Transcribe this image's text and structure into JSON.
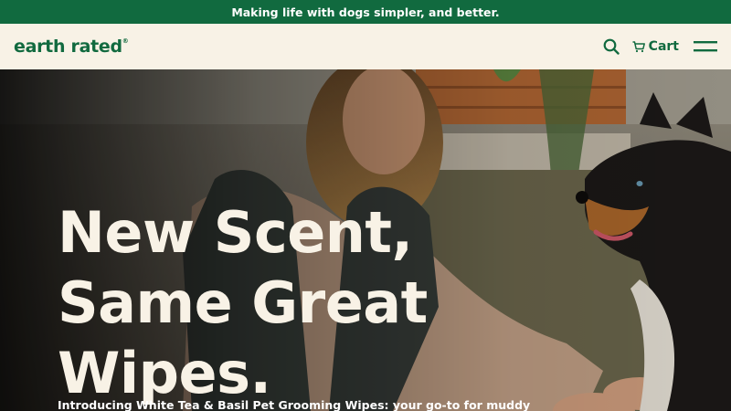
{
  "announcement": {
    "text": "Making life with dogs simpler, and better."
  },
  "header": {
    "logo_text": "earth rated",
    "logo_mark": "®",
    "cart_label": "Cart",
    "icons": {
      "search": "search-icon",
      "cart": "cart-icon",
      "menu": "hamburger-menu-icon"
    }
  },
  "hero": {
    "headline_lines": [
      "New Scent,",
      "Same Great",
      "Wipes."
    ],
    "subtext": "Introducing White Tea & Basil Pet Grooming Wipes: your go-to for muddy"
  },
  "colors": {
    "brand_green": "#116a3f",
    "cream": "#f8f2e6",
    "headline_text": "#f8f2e6"
  }
}
